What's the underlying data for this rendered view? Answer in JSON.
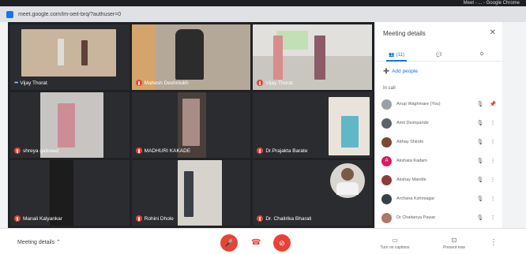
{
  "browser": {
    "url": "meet.google.com/lm-oeit-brq/?authuser=0",
    "window_title": "Meet - ... - Google Chrome"
  },
  "tiles": [
    {
      "name": "Vijay Thorat",
      "indicator": "dots"
    },
    {
      "name": "Mahesh Deshmukh",
      "indicator": "mic-off"
    },
    {
      "name": "Vijay Thorat",
      "indicator": "mic-off"
    },
    {
      "name": "shreya gaikwad",
      "indicator": "mic-off"
    },
    {
      "name": "MADHURI KAKADE",
      "indicator": "mic-off"
    },
    {
      "name": "Dr.Prajakta Barate",
      "indicator": "mic-off"
    },
    {
      "name": "Manali Kalyankar",
      "indicator": "mic-off"
    },
    {
      "name": "Rohini Dhole",
      "indicator": "mic-off"
    },
    {
      "name": "Dr. Chaitrika Bharati",
      "indicator": "mic-off"
    }
  ],
  "panel": {
    "title": "Meeting details",
    "tabs": [
      {
        "label": "(11)",
        "icon": "people-icon"
      },
      {
        "label": "",
        "icon": "chat-icon"
      },
      {
        "label": "",
        "icon": "activities-icon"
      }
    ],
    "add_people": "Add people",
    "section": "In call",
    "people": [
      {
        "name": "Anup Waghmare (You)",
        "color": "#9aa0a6",
        "initial": ""
      },
      {
        "name": "Amit Deshpande",
        "color": "#5f6368",
        "initial": ""
      },
      {
        "name": "Abhay Shinde",
        "color": "#7b4a33",
        "initial": ""
      },
      {
        "name": "Akshata Kadam",
        "color": "#d81b60",
        "initial": "A"
      },
      {
        "name": "Akshay Mandle",
        "color": "#8d3b3b",
        "initial": ""
      },
      {
        "name": "Archana Kshirsagar",
        "color": "#374047",
        "initial": ""
      },
      {
        "name": "Dr Chaitanya Pawar",
        "color": "#b0766a",
        "initial": ""
      }
    ]
  },
  "bottom": {
    "meeting_details": "Meeting details",
    "turn_on_captions": "Turn on captions",
    "present_now": "Present now"
  },
  "colors": {
    "accent": "#1a73e8",
    "danger": "#ea4335",
    "grid_bg": "#202124"
  }
}
